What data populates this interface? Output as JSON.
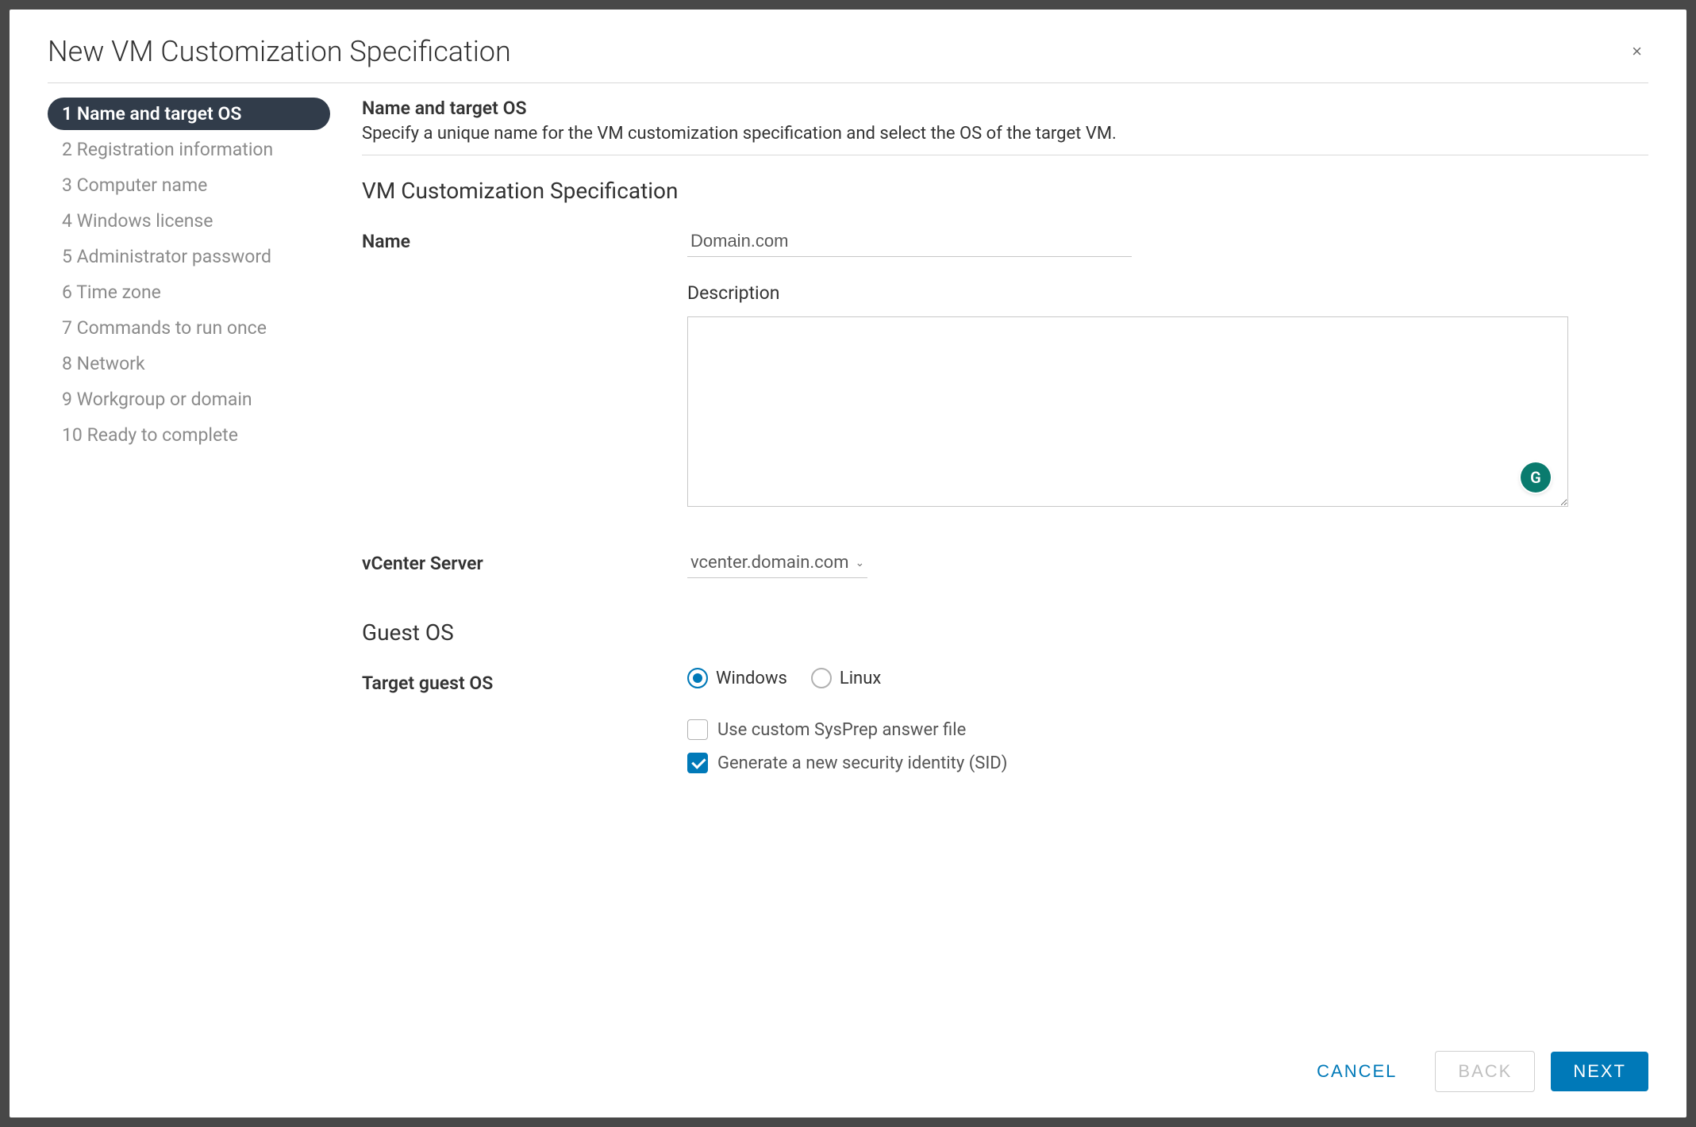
{
  "modal": {
    "title": "New VM Customization Specification",
    "close_icon": "×"
  },
  "steps": [
    {
      "num": "1",
      "label": "Name and target OS"
    },
    {
      "num": "2",
      "label": "Registration information"
    },
    {
      "num": "3",
      "label": "Computer name"
    },
    {
      "num": "4",
      "label": "Windows license"
    },
    {
      "num": "5",
      "label": "Administrator password"
    },
    {
      "num": "6",
      "label": "Time zone"
    },
    {
      "num": "7",
      "label": "Commands to run once"
    },
    {
      "num": "8",
      "label": "Network"
    },
    {
      "num": "9",
      "label": "Workgroup or domain"
    },
    {
      "num": "10",
      "label": "Ready to complete"
    }
  ],
  "section": {
    "title": "Name and target OS",
    "subtitle": "Specify a unique name for the VM customization specification and select the OS of the target VM.",
    "heading": "VM Customization Specification",
    "name_label": "Name",
    "name_value": "Domain.com",
    "description_label": "Description",
    "description_value": "",
    "vcenter_label": "vCenter Server",
    "vcenter_value": "vcenter.domain.com",
    "guest_os_heading": "Guest OS",
    "target_guest_label": "Target guest OS",
    "os_options": {
      "windows": "Windows",
      "linux": "Linux",
      "selected": "windows"
    },
    "sysprep_label": "Use custom SysPrep answer file",
    "sysprep_checked": false,
    "sid_label": "Generate a new security identity (SID)",
    "sid_checked": true
  },
  "footer": {
    "cancel": "CANCEL",
    "back": "BACK",
    "next": "NEXT"
  },
  "colors": {
    "accent": "#0079b8",
    "sidebar_active": "#313c4a"
  }
}
